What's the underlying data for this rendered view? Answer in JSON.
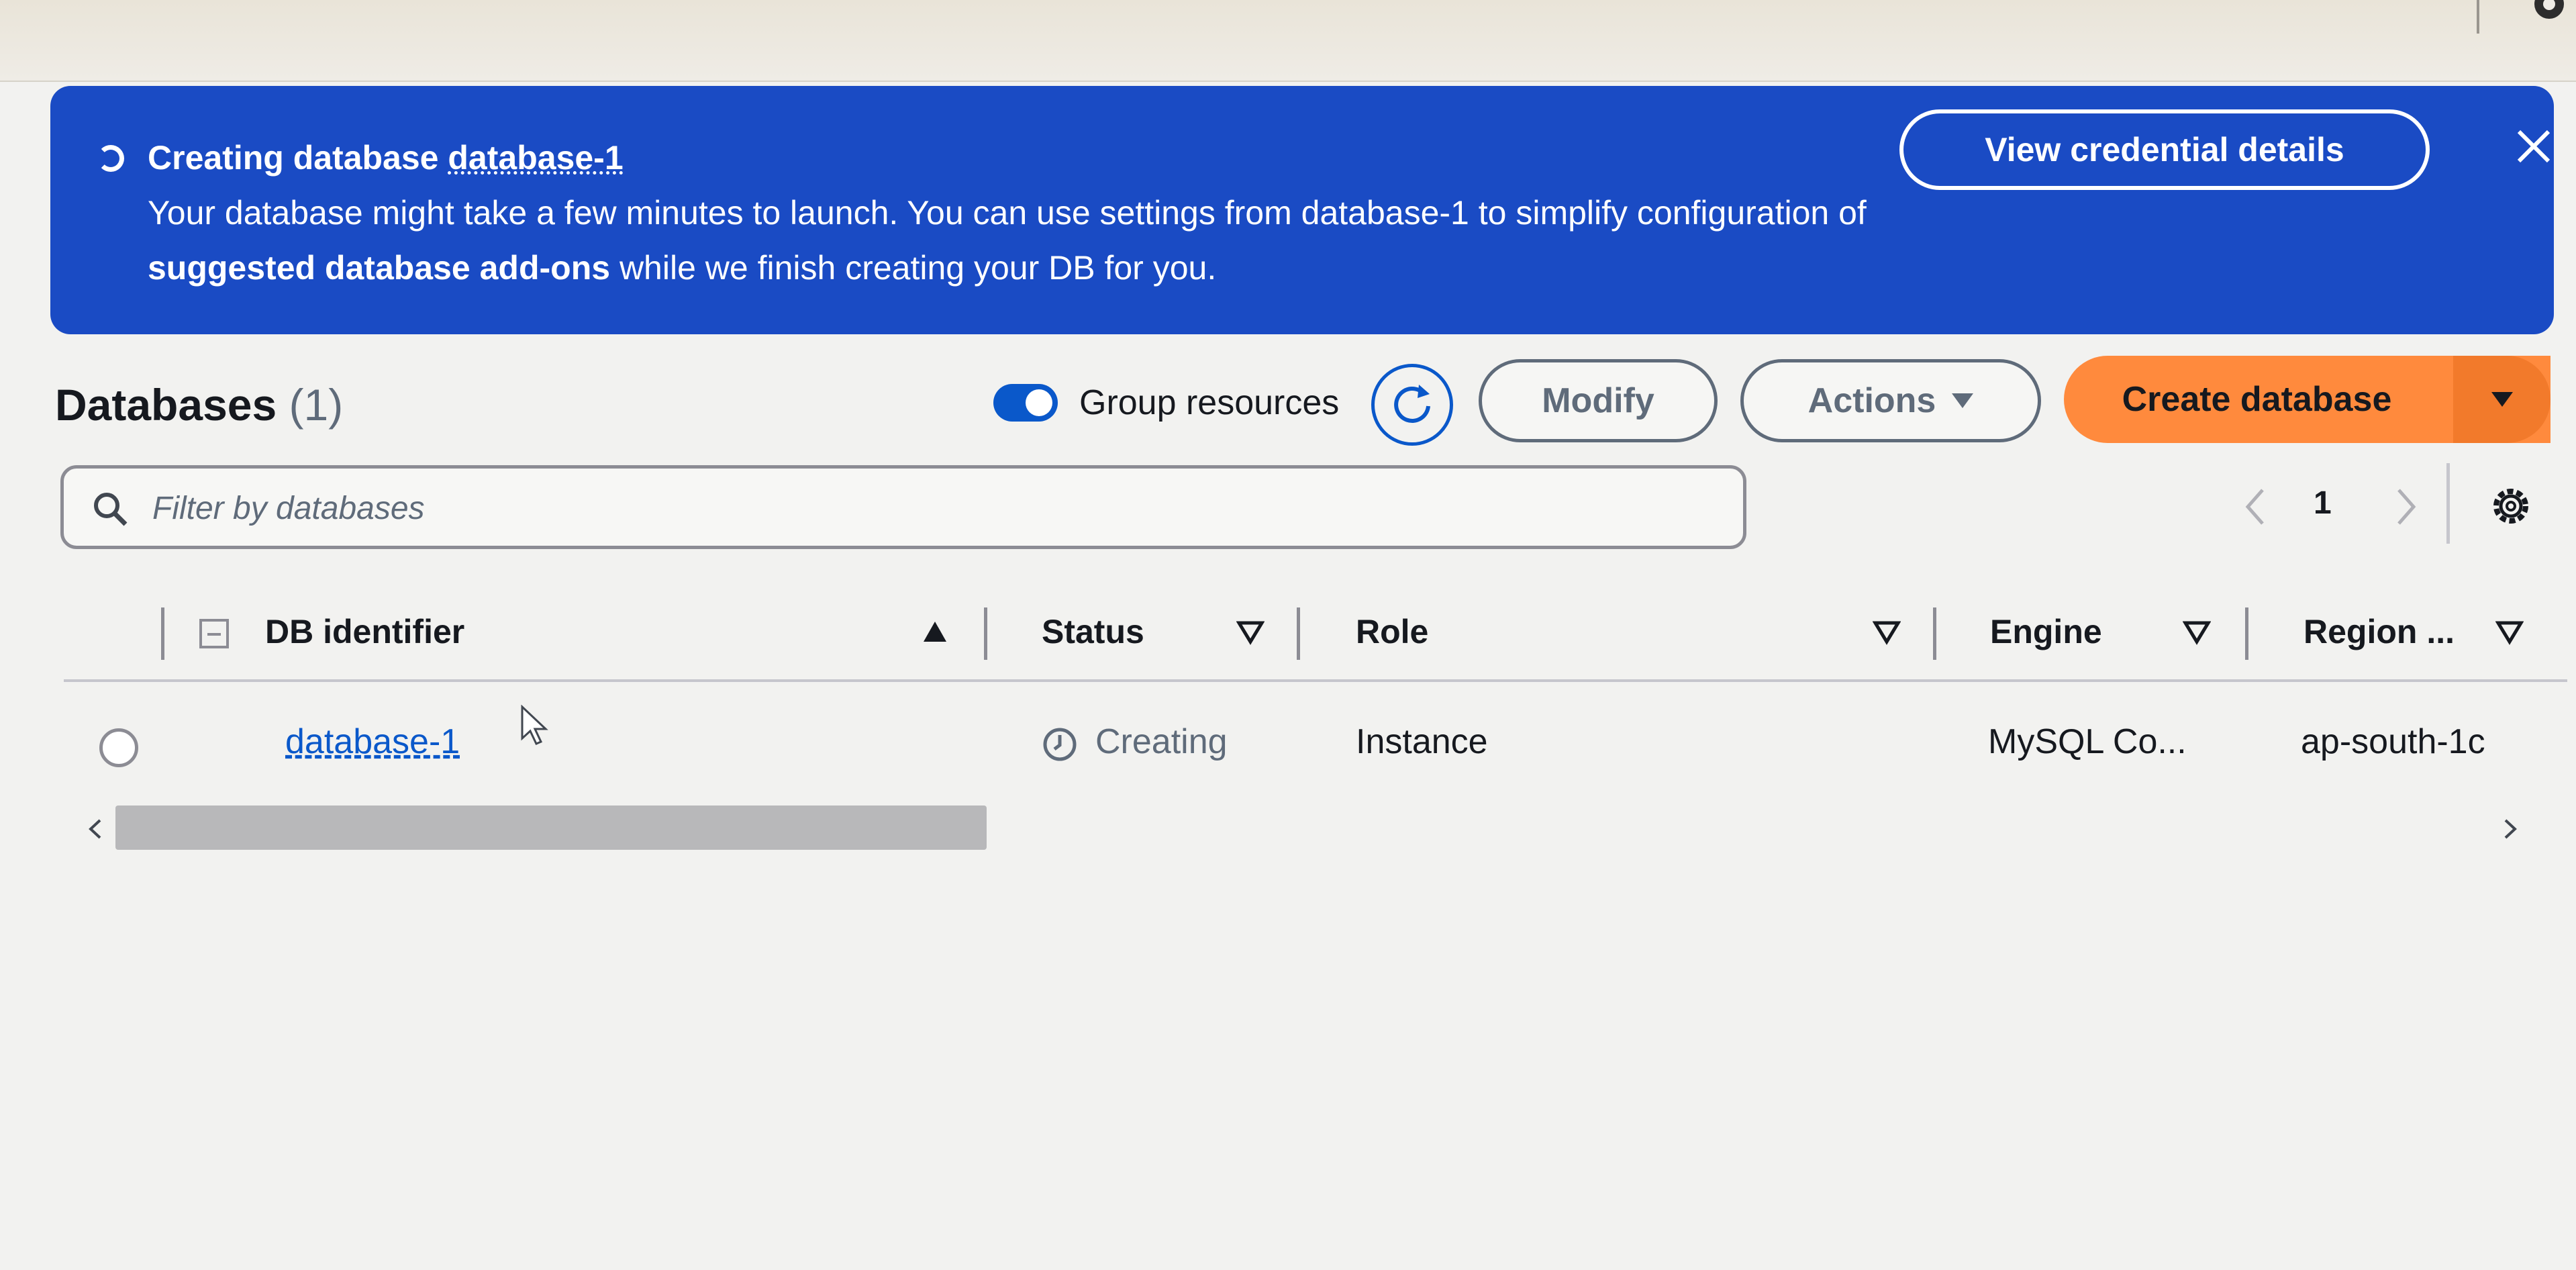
{
  "banner": {
    "title_prefix": "Creating database",
    "title_db": "database-1",
    "message_part1": "Your database might take a few minutes to launch. You can use settings from database-1 to simplify configuration of ",
    "message_bold": "suggested database add-ons",
    "message_part2": " while we finish creating your DB for you.",
    "credentials_button": "View credential details",
    "color": "#1a4bc4"
  },
  "header": {
    "title": "Databases",
    "count": "(1)",
    "group_toggle_label": "Group resources",
    "group_toggle_on": true,
    "modify_label": "Modify",
    "actions_label": "Actions",
    "create_label": "Create database",
    "create_color": "#ff8a3d"
  },
  "filter": {
    "placeholder": "Filter by databases"
  },
  "pagination": {
    "current_page": "1"
  },
  "table": {
    "columns": [
      {
        "label": "DB identifier",
        "sort": "ascending"
      },
      {
        "label": "Status",
        "sort": "none"
      },
      {
        "label": "Role",
        "sort": "none"
      },
      {
        "label": "Engine",
        "sort": "none"
      },
      {
        "label": "Region ...",
        "sort": "none"
      }
    ],
    "rows": [
      {
        "db_identifier": "database-1",
        "status": "Creating",
        "role": "Instance",
        "engine": "MySQL Co...",
        "region": "ap-south-1c"
      }
    ]
  },
  "icons": {
    "spinner": "loading-spinner-icon",
    "close": "close-icon",
    "refresh": "refresh-icon",
    "search": "search-icon",
    "settings": "gear-icon",
    "status": "clock-icon"
  }
}
